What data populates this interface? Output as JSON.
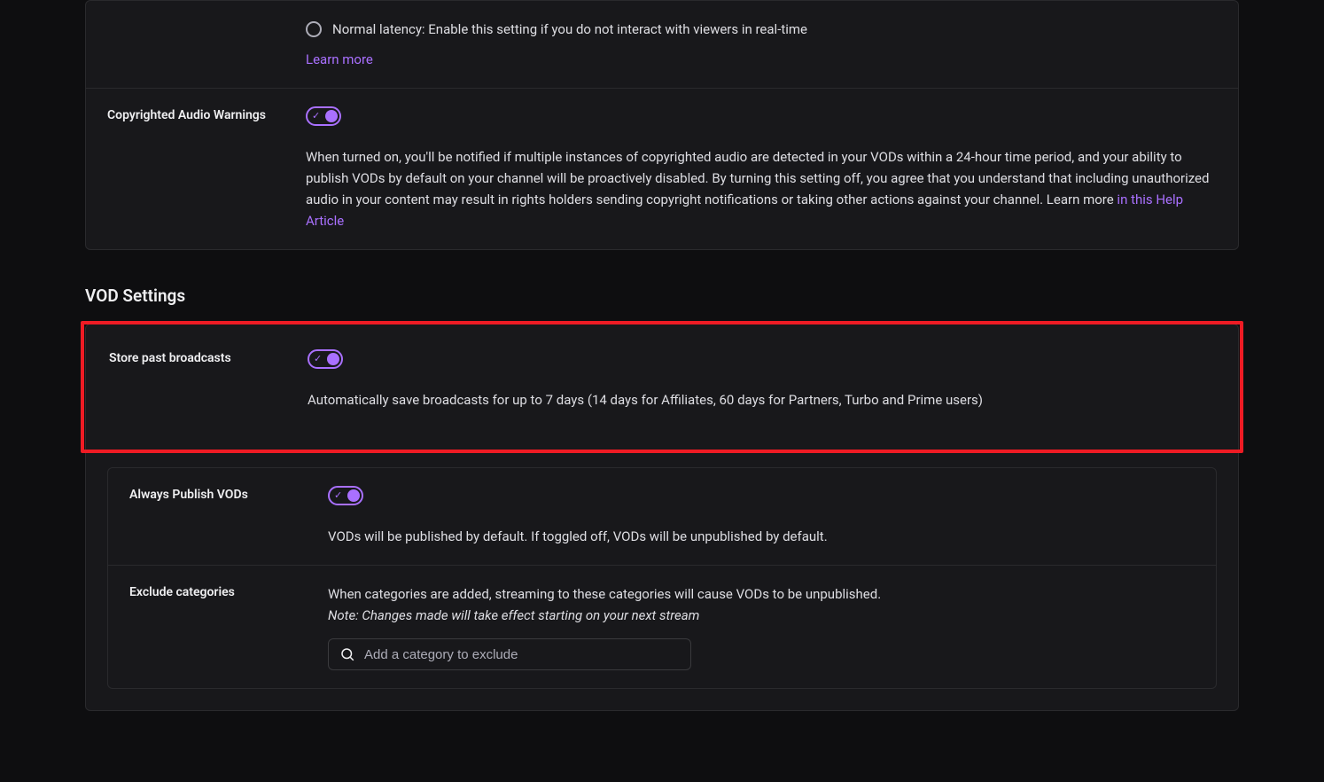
{
  "latency": {
    "normal_label": "Normal latency: Enable this setting if you do not interact with viewers in real-time",
    "learn_more": "Learn more"
  },
  "copyright_audio": {
    "title": "Copyrighted Audio Warnings",
    "description_pre": "When turned on, you'll be notified if multiple instances of copyrighted audio are detected in your VODs within a 24-hour time period, and your ability to publish VODs by default on your channel will be proactively disabled. By turning this setting off, you agree that you understand that including unauthorized audio in your content may result in rights holders sending copyright notifications or taking other actions against your channel. Learn more ",
    "help_link": "in this Help Article"
  },
  "vod_section_title": "VOD Settings",
  "store_broadcasts": {
    "title": "Store past broadcasts",
    "description": "Automatically save broadcasts for up to 7 days (14 days for Affiliates, 60 days for Partners, Turbo and Prime users)"
  },
  "always_publish": {
    "title": "Always Publish VODs",
    "description": "VODs will be published by default. If toggled off, VODs will be unpublished by default."
  },
  "exclude_categories": {
    "title": "Exclude categories",
    "description": "When categories are added, streaming to these categories will cause VODs to be unpublished.",
    "note": "Note: Changes made will take effect starting on your next stream",
    "placeholder": "Add a category to exclude"
  }
}
